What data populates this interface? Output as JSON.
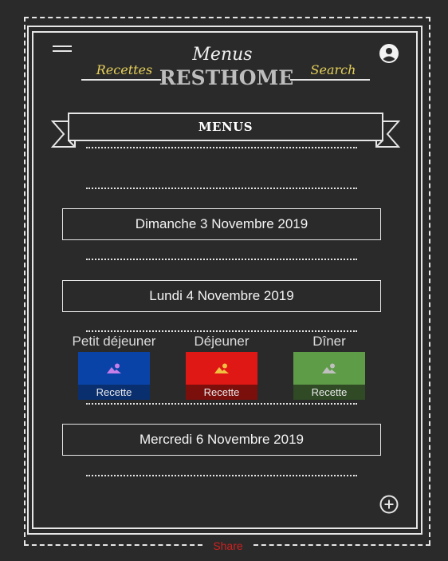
{
  "header": {
    "title_script": "Menus",
    "title_main": "RESTHOME",
    "nav_left": "Recettes",
    "nav_right": "Search"
  },
  "banner": {
    "label": "MENUS"
  },
  "days": [
    {
      "label": "Dimanche 3 Novembre 2019"
    },
    {
      "label": "Lundi 4 Novembre 2019"
    },
    {
      "label": "Mercredi 6 Novembre 2019"
    }
  ],
  "meals": [
    {
      "label": "Petit déjeuner",
      "card_label": "Recette",
      "color": "#0a43a8",
      "footer_color": "#0a2f6e",
      "icon_color": "#c77ee8"
    },
    {
      "label": "Déjeuner",
      "card_label": "Recette",
      "color": "#e01815",
      "footer_color": "#7a0f0c",
      "icon_color": "#f0c040"
    },
    {
      "label": "Dîner",
      "card_label": "Recette",
      "color": "#5e9c48",
      "footer_color": "#2f4a25",
      "icon_color": "#c0c0c0"
    }
  ],
  "footer": {
    "share_label": "Share"
  },
  "icons": {
    "menu": "hamburger-icon",
    "account": "account-circle-icon",
    "add": "add-circle-icon",
    "image": "image-icon"
  }
}
